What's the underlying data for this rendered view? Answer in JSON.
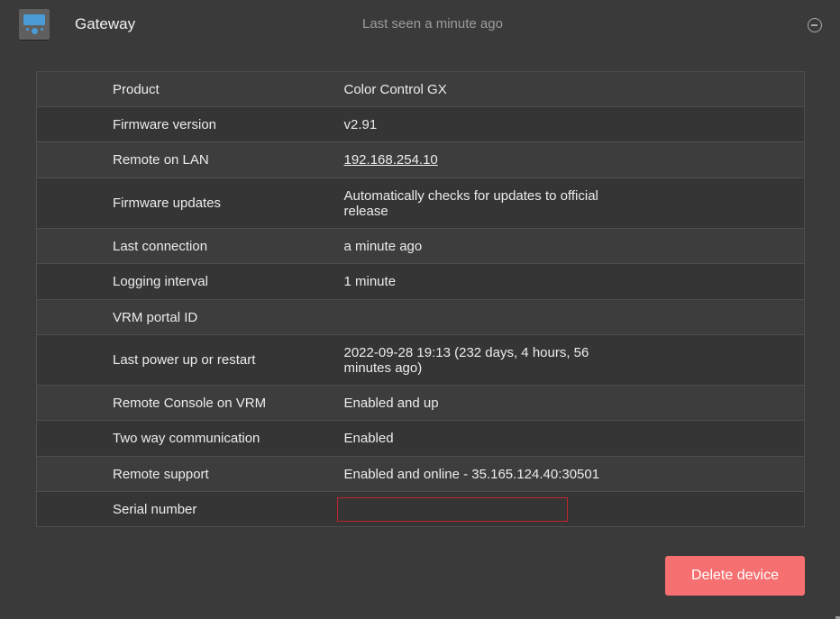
{
  "header": {
    "icon": "gx-device-icon",
    "title": "Gateway",
    "last_seen": "Last seen a minute ago",
    "collapse_icon": "minus-circle-icon"
  },
  "rows": [
    {
      "label": "Product",
      "value": "Color Control GX",
      "type": "text"
    },
    {
      "label": "Firmware version",
      "value": "v2.91",
      "type": "text"
    },
    {
      "label": "Remote on LAN",
      "value": "192.168.254.10",
      "type": "link"
    },
    {
      "label": "Firmware updates",
      "value": "Automatically checks for updates to official release",
      "type": "text"
    },
    {
      "label": "Last connection",
      "value": "a minute ago",
      "type": "text"
    },
    {
      "label": "Logging interval",
      "value": "1 minute",
      "type": "text"
    },
    {
      "label": "VRM portal ID",
      "value": "",
      "type": "text"
    },
    {
      "label": "Last power up or restart",
      "value": "2022-09-28 19:13 (232 days, 4 hours, 56 minutes ago)",
      "type": "text"
    },
    {
      "label": "Remote Console on VRM",
      "value": "Enabled and up",
      "type": "text"
    },
    {
      "label": "Two way communication",
      "value": "Enabled",
      "type": "text"
    },
    {
      "label": "Remote support",
      "value": "Enabled and online - 35.165.124.40:30501",
      "type": "text"
    },
    {
      "label": "Serial number",
      "value": "",
      "type": "redacted"
    }
  ],
  "actions": {
    "delete_label": "Delete device"
  },
  "colors": {
    "background": "#3a3a3a",
    "accent_icon": "#4a9bd6",
    "delete_button": "#f77071",
    "redaction_border": "#c0262a"
  }
}
